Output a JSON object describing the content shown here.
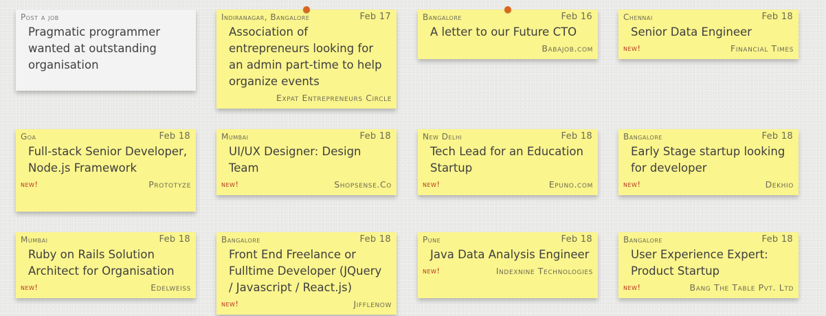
{
  "post_card": {
    "label": "Post a job",
    "title": "Pragmatic programmer wanted at outstanding organisation"
  },
  "badge_new": "new!",
  "jobs": [
    {
      "location": "Indiranagar, Bangalore",
      "date": "Feb 17",
      "title": "Association of entrepreneurs looking for an admin part-time to help organize events",
      "company": "Expat Entrepreneurs Circle",
      "new": false
    },
    {
      "location": "Bangalore",
      "date": "Feb 16",
      "title": "A letter to our Future CTO",
      "company": "Babajob.com",
      "new": false
    },
    {
      "location": "Chennai",
      "date": "Feb 18",
      "title": "Senior Data Engineer",
      "company": "Financial Times",
      "new": true
    },
    {
      "location": "Goa",
      "date": "Feb 18",
      "title": "Full-stack Senior Developer, Node.js Framework",
      "company": "Prototyze",
      "new": true
    },
    {
      "location": "Mumbai",
      "date": "Feb 18",
      "title": "UI/UX Designer: Design Team",
      "company": "Shopsense.Co",
      "new": true
    },
    {
      "location": "New Delhi",
      "date": "Feb 18",
      "title": "Tech Lead for an Education Startup",
      "company": "Epuno.com",
      "new": true
    },
    {
      "location": "Bangalore",
      "date": "Feb 18",
      "title": "Early Stage startup looking for developer",
      "company": "Dekhio",
      "new": true
    },
    {
      "location": "Mumbai",
      "date": "Feb 18",
      "title": "Ruby on Rails Solution Architect for Organisation",
      "company": "Edelweiss",
      "new": true
    },
    {
      "location": "Bangalore",
      "date": "Feb 18",
      "title": "Front End Freelance or Fulltime Developer (JQuery / Javascript / React.js)",
      "company": "Jifflenow",
      "new": true
    },
    {
      "location": "Pune",
      "date": "Feb 18",
      "title": "Java Data Analysis Engineer",
      "company": "Indexnine Technologies",
      "new": true
    },
    {
      "location": "Bangalore",
      "date": "Feb 18",
      "title": "User Experience Expert: Product Startup",
      "company": "Bang The Table Pvt. Ltd",
      "new": true
    }
  ],
  "colors": {
    "card": "#fbf58e",
    "post_card": "#f3f3f3",
    "new_badge": "#b5321c",
    "pin": "#d8661d"
  }
}
